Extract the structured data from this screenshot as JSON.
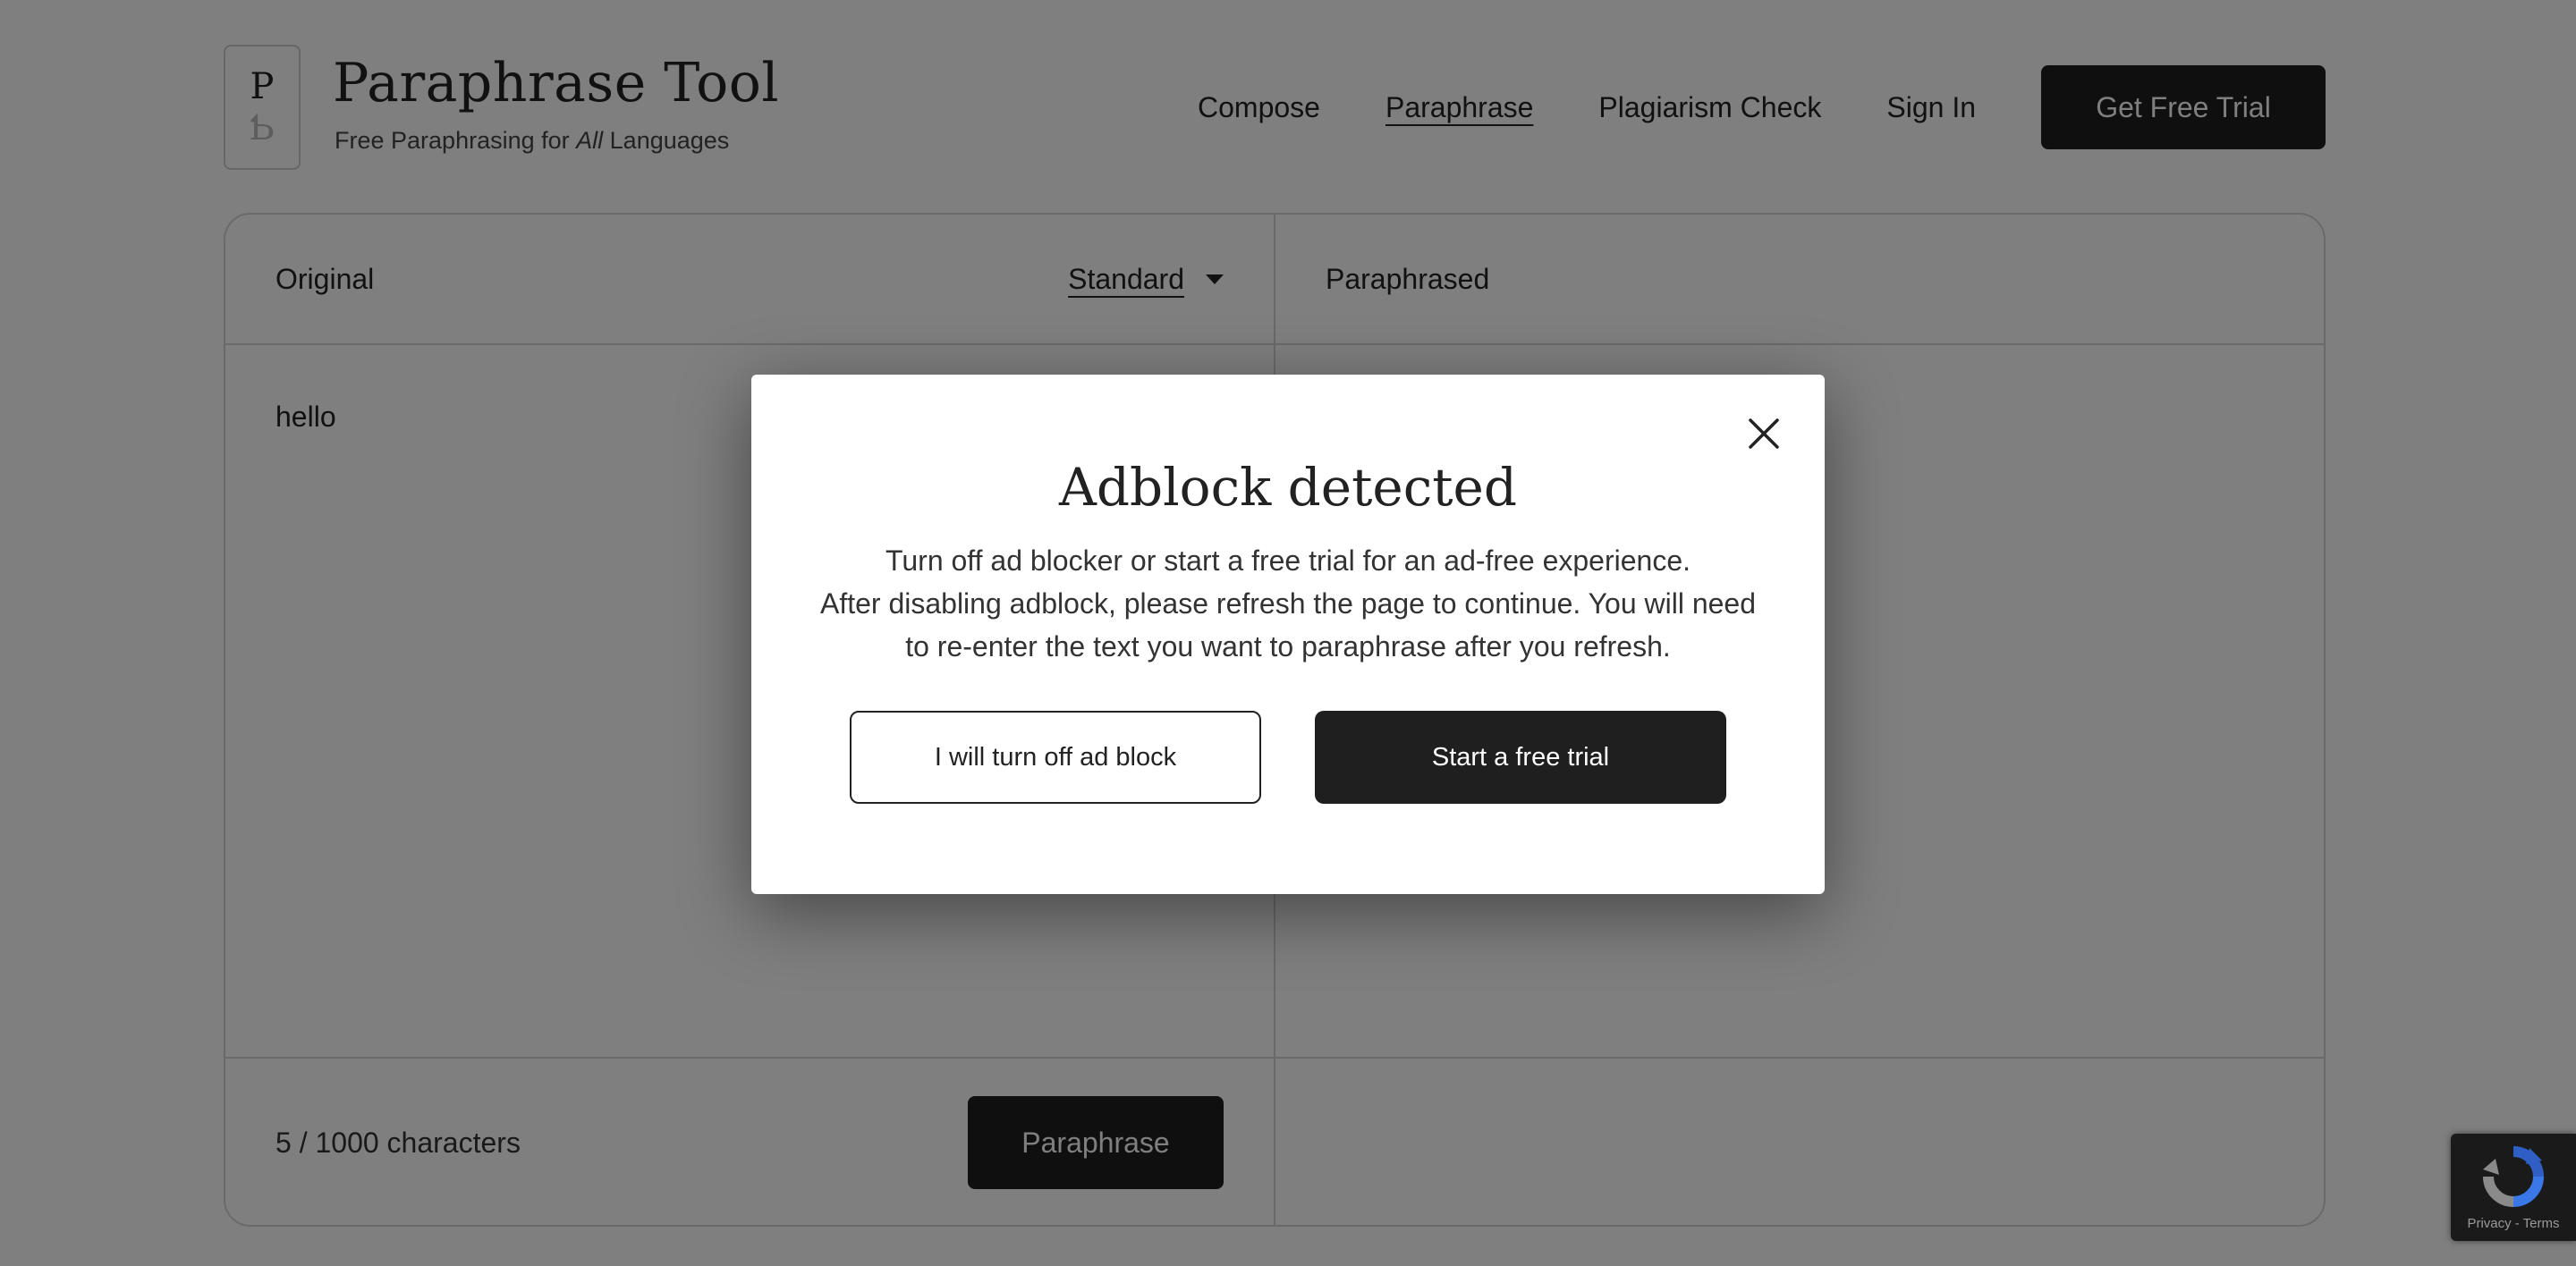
{
  "header": {
    "logo_top": "P",
    "logo_bottom": "Ƅ",
    "title": "Paraphrase Tool",
    "tagline_before": "Free Paraphrasing for ",
    "tagline_em": "All",
    "tagline_after": " Languages",
    "nav": {
      "compose": "Compose",
      "paraphrase": "Paraphrase",
      "plagiarism": "Plagiarism Check",
      "signin": "Sign In"
    },
    "trial_button": "Get Free Trial"
  },
  "editor": {
    "original": {
      "title": "Original",
      "mode": "Standard",
      "text": "hello",
      "char_count": "5 / 1000 characters",
      "button": "Paraphrase"
    },
    "paraphrased": {
      "title": "Paraphrased"
    }
  },
  "modal": {
    "title": "Adblock detected",
    "line1": "Turn off ad blocker or start a free trial for an ad-free experience.",
    "line2": "After disabling adblock, please refresh the page to continue. You will need to re-enter the text you want to paraphrase after you refresh.",
    "secondary_button": "I will turn off ad block",
    "primary_button": "Start a free trial",
    "close_icon": "close-icon"
  },
  "recaptcha": {
    "icon": "recaptcha-logo-icon",
    "links": "Privacy - Terms"
  },
  "colors": {
    "dark_button": "#1f1f1f",
    "overlay": "rgba(0,0,0,0.5)",
    "border": "#d4d4d4"
  }
}
